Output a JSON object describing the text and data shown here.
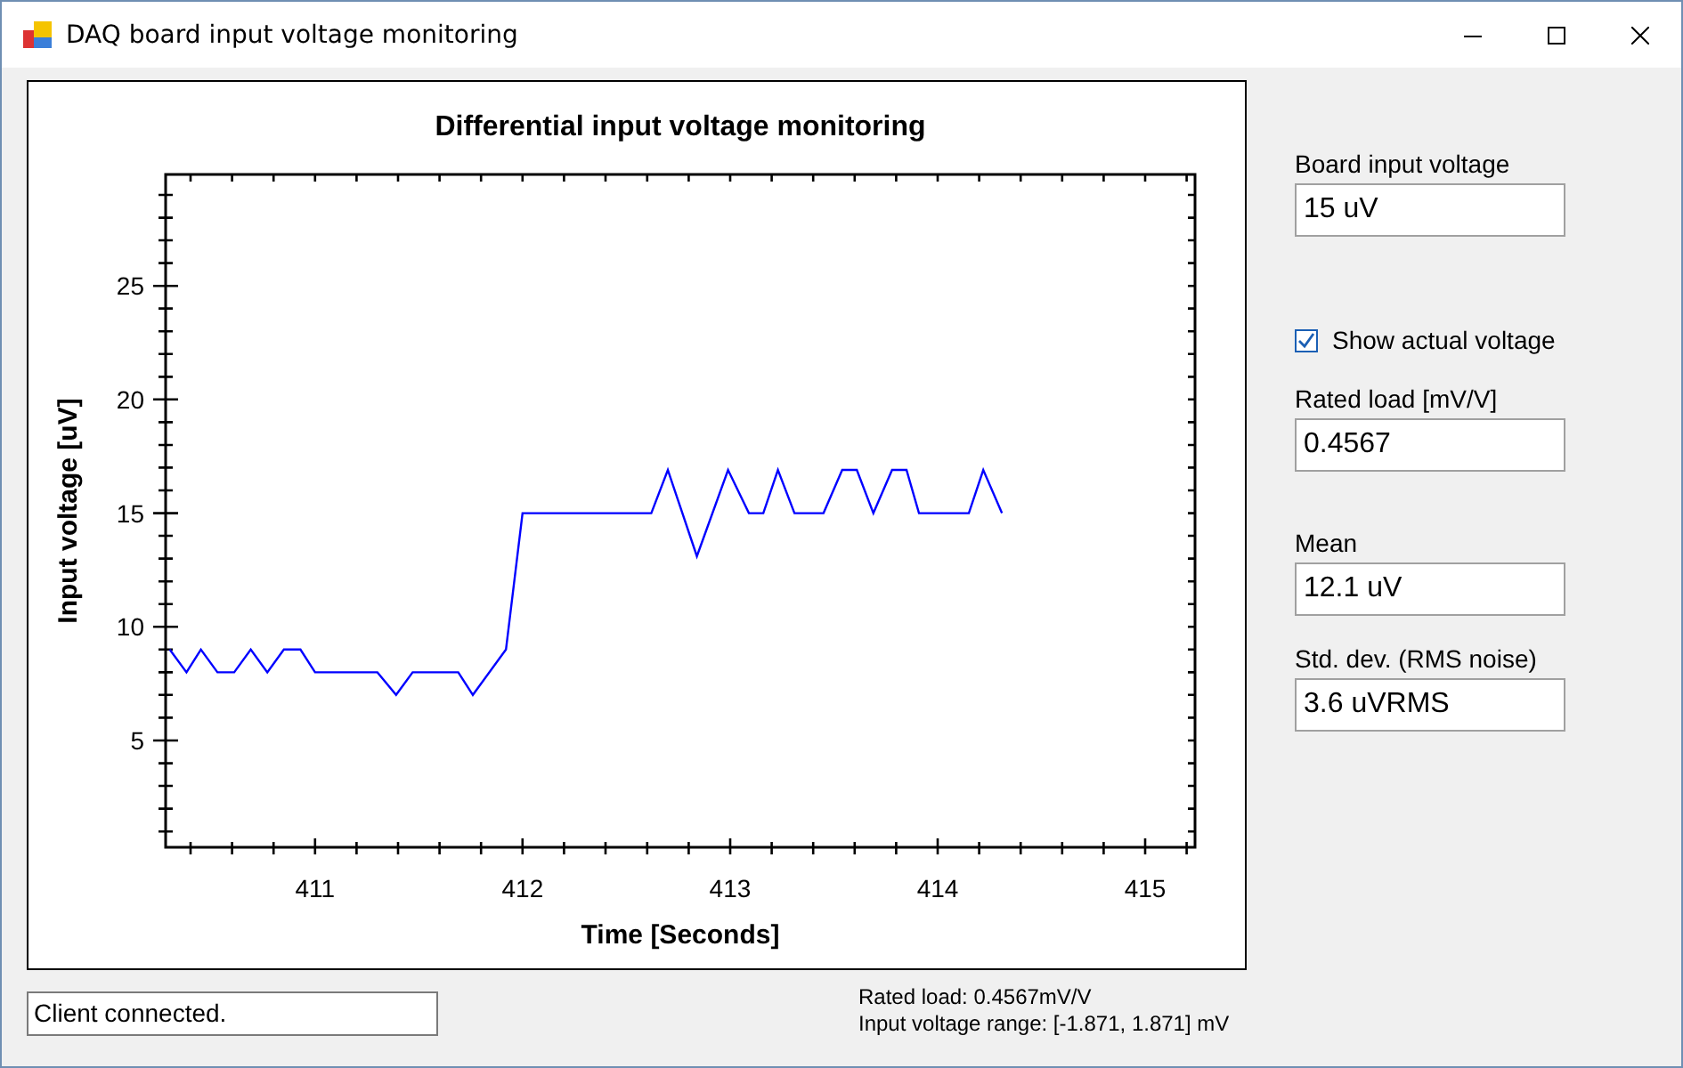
{
  "window": {
    "title": "DAQ board input voltage monitoring"
  },
  "chart": {
    "chart_data": {
      "type": "line",
      "title": "Differential input voltage monitoring",
      "xlabel": "Time [Seconds]",
      "ylabel": "Input voltage [uV]",
      "x": [
        410.3,
        410.38,
        410.45,
        410.53,
        410.61,
        410.69,
        410.77,
        410.85,
        410.93,
        411.0,
        411.3,
        411.39,
        411.47,
        411.69,
        411.76,
        411.92,
        412.0,
        412.62,
        412.7,
        412.84,
        412.99,
        413.09,
        413.16,
        413.23,
        413.31,
        413.45,
        413.54,
        413.61,
        413.69,
        413.78,
        413.85,
        413.91,
        414.15,
        414.22,
        414.31
      ],
      "series": [
        {
          "color": "#0000ff",
          "values": [
            9,
            8,
            9,
            8,
            8,
            9,
            8,
            9,
            9,
            8,
            8,
            7,
            8,
            8,
            7,
            9,
            15,
            15,
            16.9,
            13.1,
            16.9,
            15,
            15,
            16.9,
            15,
            15,
            16.9,
            16.9,
            15,
            16.9,
            16.9,
            15,
            15,
            16.9,
            15
          ]
        }
      ],
      "xlim": [
        410.28,
        415.24
      ],
      "ylim": [
        0.3,
        29.9
      ],
      "xticks": [
        411,
        412,
        413,
        414,
        415
      ],
      "yticks": [
        5,
        10,
        15,
        20,
        25
      ]
    }
  },
  "controls": [
    {
      "kind": "field",
      "label": "Board input voltage",
      "value": "15 uV"
    },
    {
      "kind": "checkbox",
      "label": "Show actual voltage",
      "checked": true
    },
    {
      "kind": "field",
      "label": "Rated load [mV/V]",
      "value": "0.4567"
    },
    {
      "kind": "field",
      "label": "Mean",
      "value": "12.1 uV"
    },
    {
      "kind": "field",
      "label": "Std. dev. (RMS noise)",
      "value": "3.6 uVRMS"
    }
  ],
  "status_field": {
    "value": "Client connected."
  },
  "info_lines": [
    "Rated load: 0.4567mV/V",
    "Input voltage range: [-1.871, 1.871] mV"
  ]
}
